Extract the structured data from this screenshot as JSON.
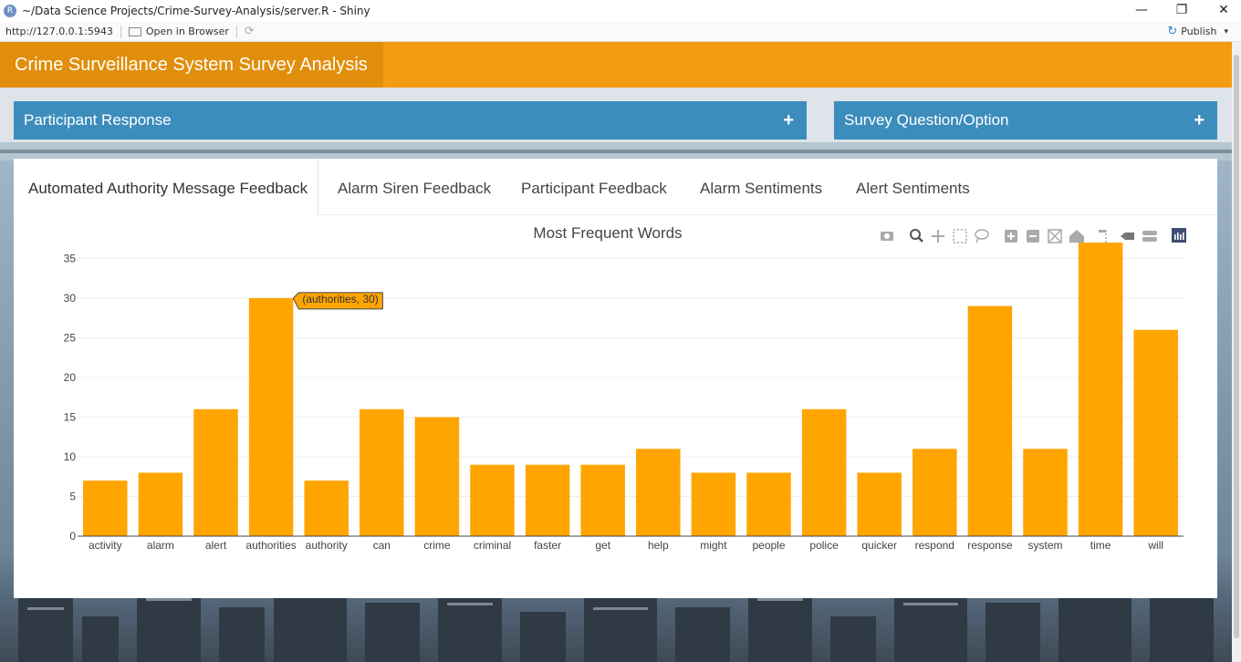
{
  "window": {
    "title": "~/Data Science Projects/Crime-Survey-Analysis/server.R - Shiny",
    "app_icon_letter": "R",
    "minimize": "—",
    "restore": "❐",
    "close": "✕"
  },
  "addressbar": {
    "url": "http://127.0.0.1:5943",
    "open_in_browser": "Open in Browser",
    "refresh_icon": "⟳",
    "publish": "Publish",
    "publish_icon": "↻",
    "publish_caret": "▾"
  },
  "app": {
    "title": "Crime Surveillance System Survey Analysis",
    "header_color": "#f39c12",
    "brand_color": "#e08e0b"
  },
  "boxes": [
    {
      "title": "Participant Response",
      "toggle": "+"
    },
    {
      "title": "Survey Question/Option",
      "toggle": "+"
    }
  ],
  "tabs": [
    {
      "label": "Automated Authority Message Feedback",
      "active": true
    },
    {
      "label": "Alarm Siren Feedback",
      "active": false
    },
    {
      "label": "Participant Feedback",
      "active": false
    },
    {
      "label": "Alarm Sentiments",
      "active": false
    },
    {
      "label": "Alert Sentiments",
      "active": false
    }
  ],
  "modebar_icons": [
    "camera-icon",
    "zoom-icon",
    "pan-icon",
    "box-select-icon",
    "lasso-icon",
    "zoom-in-icon",
    "zoom-out-icon",
    "autoscale-icon",
    "reset-axes-icon",
    "spike-lines-icon",
    "hover-closest-icon",
    "hover-compare-icon",
    "plotly-logo-icon"
  ],
  "chart_data": {
    "type": "bar",
    "title": "Most Frequent Words",
    "xlabel": "",
    "ylabel": "",
    "categories": [
      "activity",
      "alarm",
      "alert",
      "authorities",
      "authority",
      "can",
      "crime",
      "criminal",
      "faster",
      "get",
      "help",
      "might",
      "people",
      "police",
      "quicker",
      "respond",
      "response",
      "system",
      "time",
      "will"
    ],
    "values": [
      7,
      8,
      16,
      30,
      7,
      16,
      15,
      9,
      9,
      9,
      11,
      8,
      8,
      16,
      8,
      11,
      29,
      11,
      37,
      26
    ],
    "ylim": [
      0,
      37
    ],
    "yticks": [
      0,
      5,
      10,
      15,
      20,
      25,
      30,
      35
    ],
    "bar_color": "#ffa500",
    "grid": true,
    "tooltip": {
      "label": "(authorities, 30)",
      "category": "authorities"
    }
  }
}
